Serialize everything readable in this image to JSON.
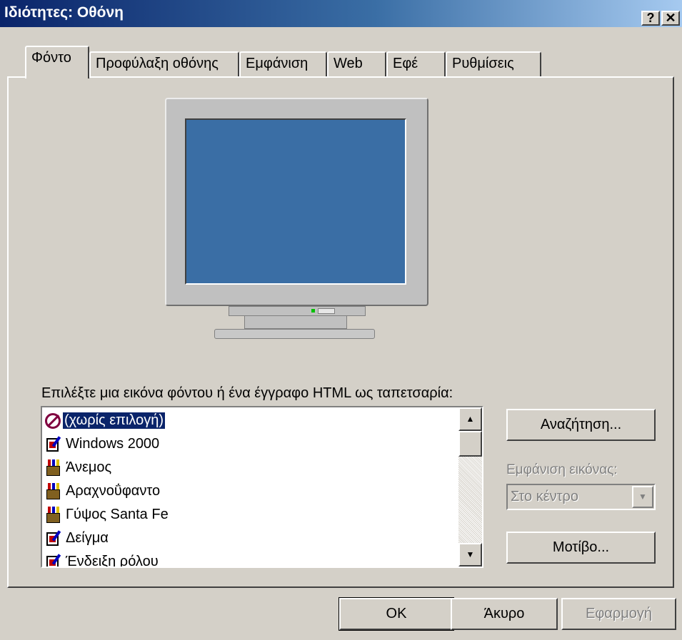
{
  "window": {
    "title": "Ιδιότητες: Οθόνη",
    "help_button": "?",
    "close_button": "✕"
  },
  "tabs": [
    {
      "label": "Φόντο",
      "active": true
    },
    {
      "label": "Προφύλαξη οθόνης"
    },
    {
      "label": "Εμφάνιση"
    },
    {
      "label": "Web"
    },
    {
      "label": "Εφέ"
    },
    {
      "label": "Ρυθμίσεις"
    }
  ],
  "wallpaper": {
    "label": "Επιλέξτε μια εικόνα φόντου ή ένα έγγραφο HTML ως ταπετσαρία:",
    "items": [
      {
        "label": "(χωρίς επιλογή)",
        "icon": "no-entry-icon",
        "selected": true
      },
      {
        "label": "Windows 2000",
        "icon": "document-icon"
      },
      {
        "label": "Άνεμος",
        "icon": "paintbrush-icon"
      },
      {
        "label": "Αραχνοΰφαντο",
        "icon": "paintbrush-icon"
      },
      {
        "label": "Γύψος Santa Fe",
        "icon": "paintbrush-icon"
      },
      {
        "label": "Δείγμα",
        "icon": "document-icon"
      },
      {
        "label": "Ένδειξη ρόλου",
        "icon": "document-icon"
      }
    ]
  },
  "side": {
    "browse_button": "Αναζήτηση...",
    "display_label": "Εμφάνιση εικόνας:",
    "display_value": "Στο κέντρο",
    "pattern_button": "Μοτίβο..."
  },
  "footer": {
    "ok": "OK",
    "cancel": "Άκυρο",
    "apply": "Εφαρμογή"
  },
  "colors": {
    "desktop": "#3a6ea5",
    "selection": "#0a246a"
  }
}
